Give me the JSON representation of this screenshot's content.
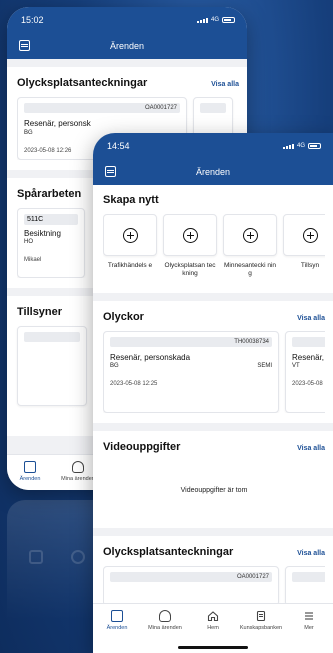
{
  "back": {
    "time": "15:02",
    "network": "4G",
    "nav_title": "Ärenden",
    "sections": [
      {
        "title": "Olycksplatsanteckningar",
        "link": "Visa alla",
        "card": {
          "id": "OA0001727",
          "title": "Resenär, personsk",
          "sub": "BG",
          "date": "2023-05-08 12:26"
        }
      },
      {
        "title": "Spårarbeten",
        "card": {
          "code": "511C",
          "title": "Besiktning",
          "sub": "HO",
          "person": "Mikael"
        }
      },
      {
        "title": "Tillsyner"
      }
    ],
    "tabs": [
      "Ärenden",
      "Mina ärenden"
    ]
  },
  "front": {
    "time": "14:54",
    "network": "4G",
    "nav_title": "Ärenden",
    "create": {
      "title": "Skapa nytt",
      "actions": [
        {
          "label": "Trafikhändels e"
        },
        {
          "label": "Olycksplatsan teckning"
        },
        {
          "label": "Minnesantecki ning"
        },
        {
          "label": "Tillsyn"
        }
      ]
    },
    "accidents": {
      "title": "Olyckor",
      "link": "Visa alla",
      "card": {
        "id": "TH00038734",
        "title": "Resenär, personskada",
        "sub_left": "BG",
        "sub_right": "SEMI",
        "date": "2023-05-08 12:25"
      },
      "card2": {
        "title": "Resenär,",
        "sub": "VT",
        "date": "2023-05-08"
      }
    },
    "videos": {
      "title": "Videouppgifter",
      "link": "Visa alla",
      "empty": "Videouppgifter är tom"
    },
    "notes": {
      "title": "Olycksplatsanteckningar",
      "link": "Visa alla",
      "card": {
        "id": "OA0001727"
      }
    },
    "tabs": [
      {
        "label": "Ärenden",
        "icon": "edit-icon"
      },
      {
        "label": "Mina ärenden",
        "icon": "person-icon"
      },
      {
        "label": "Hem",
        "icon": "home-icon"
      },
      {
        "label": "Kunskapsbanken",
        "icon": "book-icon"
      },
      {
        "label": "Mer",
        "icon": "menu-icon"
      }
    ]
  },
  "colors": {
    "primary": "#1c4f95",
    "background": "#163f7c"
  }
}
